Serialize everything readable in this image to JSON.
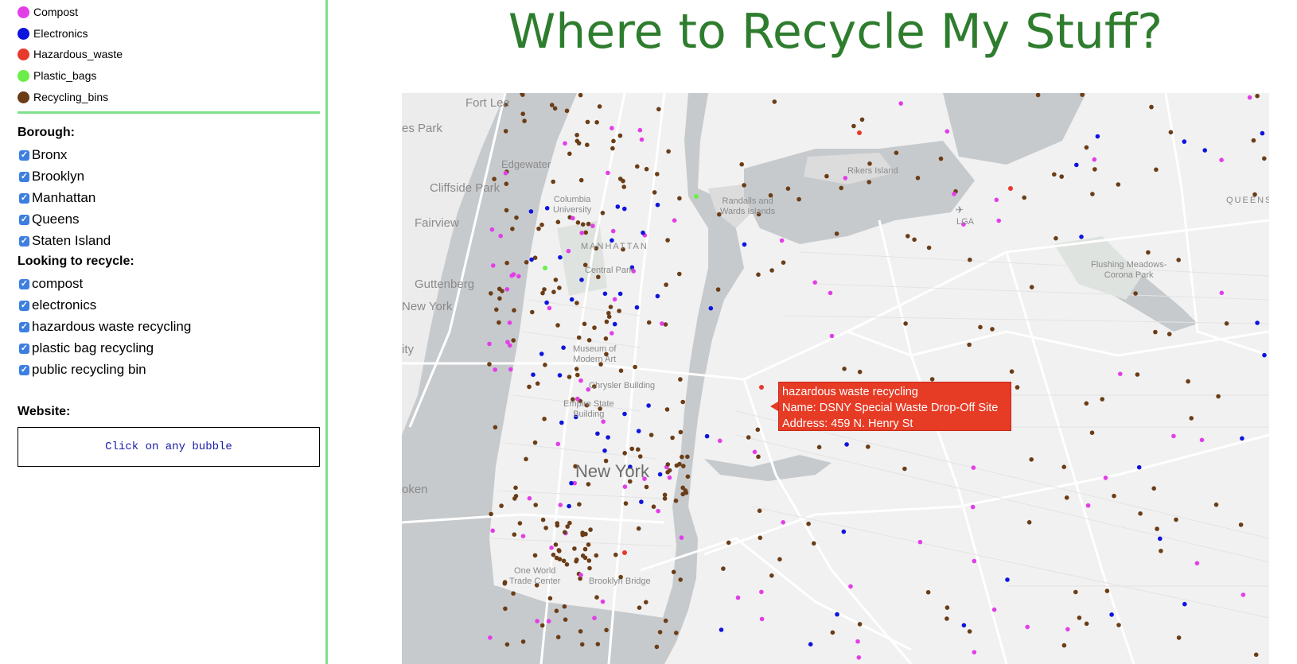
{
  "legend": {
    "items": [
      {
        "label": "Compost",
        "color": "#e23ee8"
      },
      {
        "label": "Electronics",
        "color": "#0d15dc"
      },
      {
        "label": "Hazardous_waste",
        "color": "#e73a2c"
      },
      {
        "label": "Plastic_bags",
        "color": "#6aef4a"
      },
      {
        "label": "Recycling_bins",
        "color": "#6b3d16"
      }
    ]
  },
  "filters": {
    "borough_heading": "Borough:",
    "boroughs": [
      {
        "label": "Bronx",
        "checked": true
      },
      {
        "label": "Brooklyn",
        "checked": true
      },
      {
        "label": "Manhattan",
        "checked": true
      },
      {
        "label": "Queens",
        "checked": true
      },
      {
        "label": "Staten Island",
        "checked": true
      }
    ],
    "recycle_heading": "Looking to recycle:",
    "types": [
      {
        "label": "compost",
        "checked": true
      },
      {
        "label": "electronics",
        "checked": true
      },
      {
        "label": "hazardous waste recycling",
        "checked": true
      },
      {
        "label": "plastic bag recycling",
        "checked": true
      },
      {
        "label": "public recycling bin",
        "checked": true
      }
    ]
  },
  "website": {
    "heading": "Website:",
    "text": "Click on any bubble"
  },
  "header": {
    "title": "Where to Recycle My Stuff?"
  },
  "map": {
    "labels": {
      "fort_lee": "Fort Lee",
      "es_park": "es Park",
      "edgewater": "Edgewater",
      "cliffside_park": "Cliffside Park",
      "fairview": "Fairview",
      "guttenberg": "Guttenberg",
      "new_york_nj": "New York",
      "city": "ity",
      "oken": "oken",
      "columbia": "Columbia\nUniversity",
      "manhattan": "MANHATTAN",
      "central_park": "Central Park",
      "museum": "Museum of\nModern Art",
      "chrysler": "Chrysler Building",
      "empire_state": "Empire State\nBuilding",
      "new_york": "New York",
      "one_world": "One World\nTrade Center",
      "brooklyn_bridge": "Brooklyn Bridge",
      "randalls": "Randalls and\nWards Islands",
      "rikers": "Rikers Island",
      "lga": "LGA",
      "queens": "QUEENS",
      "flushing": "Flushing Meadows-\nCorona Park"
    },
    "marker_colors": {
      "compost": "#e23ee8",
      "electronics": "#0d15dc",
      "hazardous": "#e73a2c",
      "plastic": "#6aef4a",
      "bins": "#6b3d16"
    },
    "tooltip": {
      "line1": "hazardous waste recycling",
      "line2": "Name: DSNY Special Waste Drop-Off Site",
      "line3": "Address: 459 N. Henry St"
    }
  }
}
